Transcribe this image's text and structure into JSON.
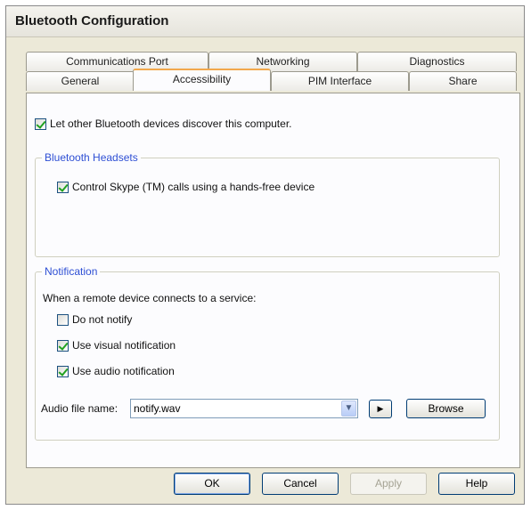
{
  "window": {
    "title": "Bluetooth Configuration"
  },
  "tabs": {
    "row1": [
      "Communications Port",
      "Networking",
      "Diagnostics"
    ],
    "row2": [
      "General",
      "Accessibility",
      "PIM Interface",
      "Share"
    ],
    "active": "Accessibility"
  },
  "accessibility": {
    "discover_label": "Let other Bluetooth devices discover this computer.",
    "discover_checked": true,
    "headsets": {
      "legend": "Bluetooth Headsets",
      "skype_label": "Control Skype (TM) calls using a hands-free device",
      "skype_checked": true
    },
    "notification": {
      "legend": "Notification",
      "prompt": "When a remote device connects to a service:",
      "do_not_notify_label": "Do not notify",
      "do_not_notify_checked": false,
      "visual_label": "Use visual notification",
      "visual_checked": true,
      "audio_label": "Use audio notification",
      "audio_checked": true,
      "audio_file_label": "Audio file name:",
      "audio_file_value": "notify.wav",
      "play_glyph": "▶",
      "browse_label": "Browse"
    }
  },
  "footer": {
    "ok_label": "OK",
    "cancel_label": "Cancel",
    "apply_label": "Apply",
    "apply_enabled": false,
    "help_label": "Help"
  },
  "icons": {
    "dropdown": "chevron-down-icon",
    "play": "play-icon",
    "check": "checkmark-icon"
  },
  "colors": {
    "active_tab_accent": "#f2a84b",
    "group_legend": "#2e4fd4",
    "check_mark": "#21a121"
  }
}
